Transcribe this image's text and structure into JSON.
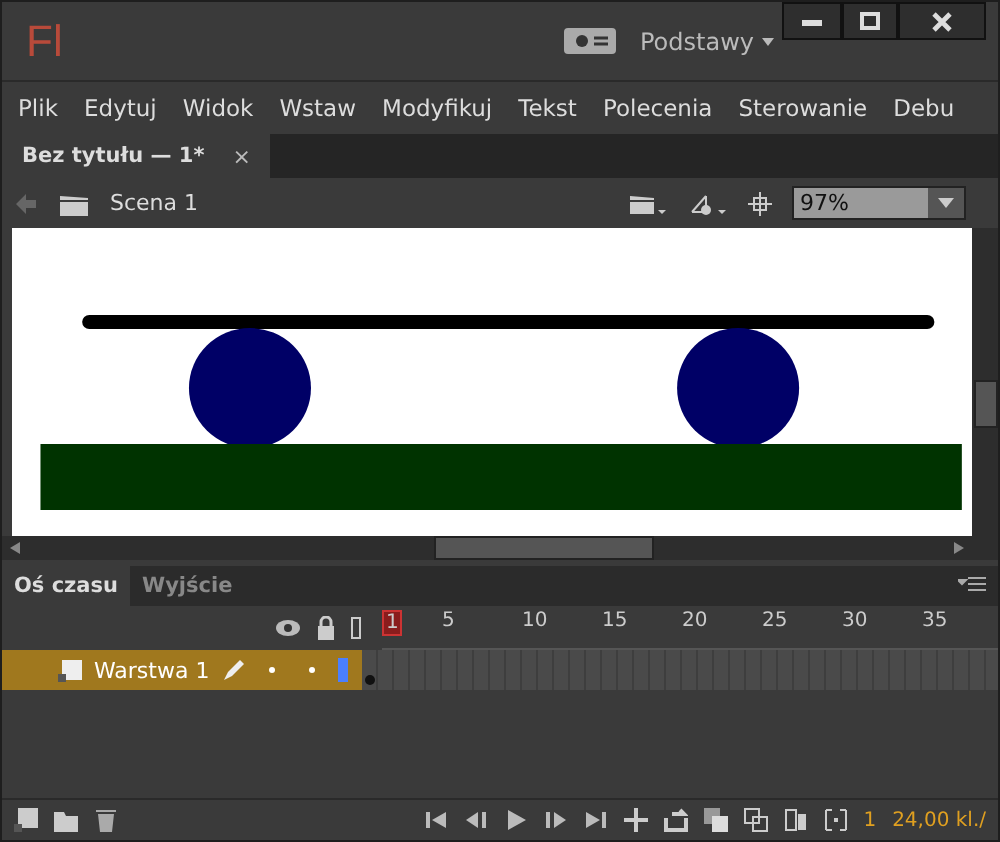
{
  "app": {
    "logo": "Fl",
    "workspace": "Podstawy"
  },
  "menu": [
    "Plik",
    "Edytuj",
    "Widok",
    "Wstaw",
    "Modyfikuj",
    "Tekst",
    "Polecenia",
    "Sterowanie",
    "Debu"
  ],
  "document_tab": {
    "title": "Bez tytułu — 1*",
    "close": "×"
  },
  "scene_bar": {
    "scene": "Scena 1",
    "zoom": "97%"
  },
  "timeline": {
    "tabs": [
      {
        "label": "Oś czasu",
        "selected": true
      },
      {
        "label": "Wyjście",
        "selected": false
      }
    ],
    "frame_numbers": [
      "1",
      "5",
      "10",
      "15",
      "20",
      "25",
      "30",
      "35"
    ],
    "layers": [
      {
        "name": "Warstwa 1",
        "selected": true
      }
    ],
    "current_frame": "1",
    "frame_rate": "24,00 kl./"
  }
}
